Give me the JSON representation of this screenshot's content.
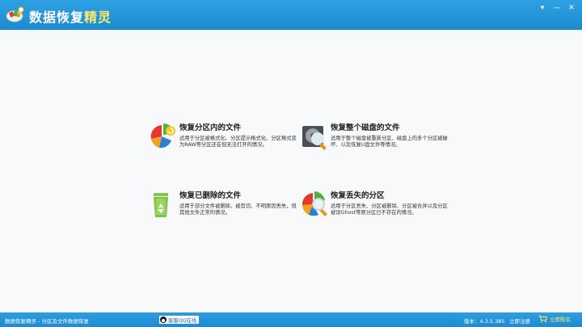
{
  "app": {
    "title_main": "数据恢复",
    "title_accent": "精灵"
  },
  "window_controls": {
    "menu": "▾",
    "minimize": "—",
    "close": "✕"
  },
  "cards": [
    {
      "title": "恢复分区内的文件",
      "desc": "适用于分区被格式化、分区提示格式化、分区格式变为RAW等分区还在但无法打开的情况。",
      "icon": "pie-chart-refresh-icon"
    },
    {
      "title": "恢复整个磁盘的文件",
      "desc": "适用于整个磁盘被重新分区、磁盘上的多个分区被破坏、以及恢复U盘文件等情况。",
      "icon": "disk-magnifier-icon"
    },
    {
      "title": "恢复已删除的文件",
      "desc": "适用于部分文件被删除、被剪切、不明原因丢失，但其他文件正常的情况。",
      "icon": "recycle-bin-icon"
    },
    {
      "title": "恢复丢失的分区",
      "desc": "适用于分区丢失、分区被删除、分区被合并以及分区被误Ghost等原分区已不存在的情况。",
      "icon": "pie-chart-magnifier-icon"
    }
  ],
  "statusbar": {
    "left_text": "数据恢复精灵 - 分区及文件数据恢复",
    "qq_label": "客服QQ在线",
    "version": "版本：4.3.5.385",
    "register": "立即注册",
    "buy": "立即购买"
  },
  "colors": {
    "titlebar": "#1f91d6",
    "accent": "#ffe96b",
    "background": "#f7f9fb"
  }
}
